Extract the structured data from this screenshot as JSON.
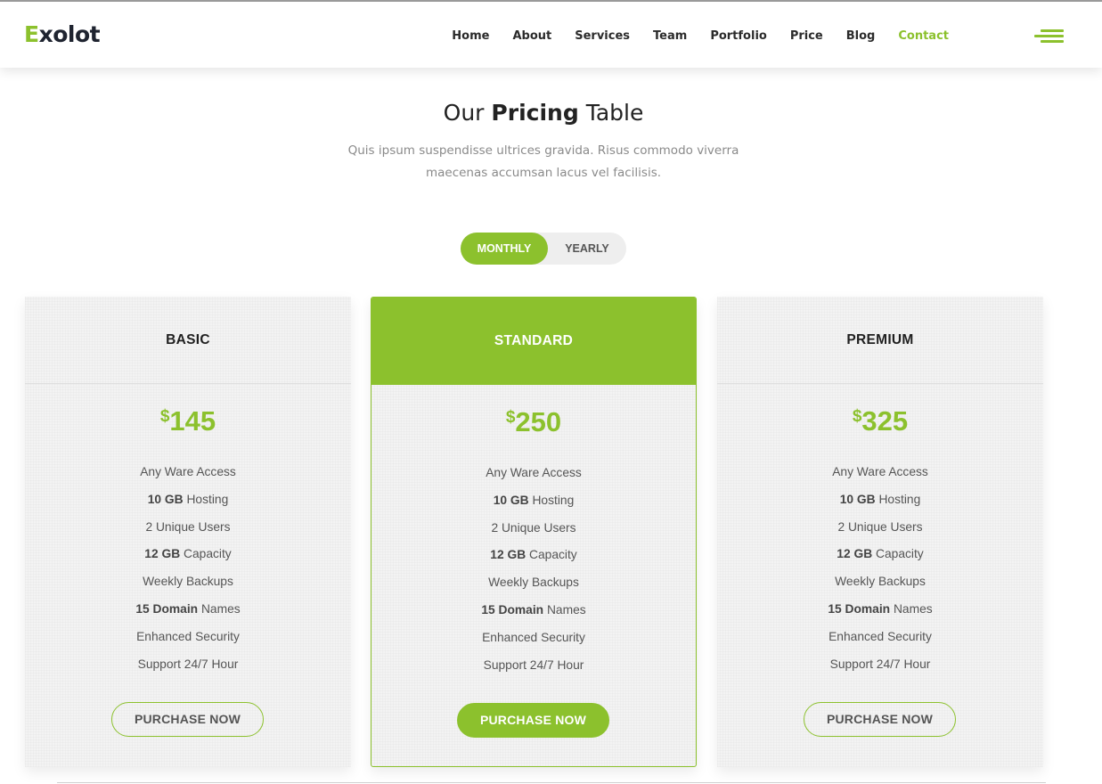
{
  "brand": {
    "first_letter": "E",
    "rest": "xolot",
    "accent_color": "#8cc12d"
  },
  "nav": {
    "items": [
      {
        "label": "Home"
      },
      {
        "label": "About"
      },
      {
        "label": "Services"
      },
      {
        "label": "Team"
      },
      {
        "label": "Portfolio"
      },
      {
        "label": "Price"
      },
      {
        "label": "Blog"
      },
      {
        "label": "Contact",
        "active": true
      }
    ],
    "menu_icon": "hamburger-menu-icon"
  },
  "section": {
    "title_prefix": "Our",
    "title_bold": "Pricing",
    "title_suffix": "Table",
    "description": "Quis ipsum suspendisse ultrices gravida. Risus commodo viverra maecenas accumsan lacus vel facilisis."
  },
  "billing_toggle": {
    "monthly": "MONTHLY",
    "yearly": "YEARLY",
    "selected": "MONTHLY"
  },
  "plans": [
    {
      "name": "BASIC",
      "currency": "$",
      "price": "145",
      "featured": false,
      "features": [
        {
          "bold": "",
          "text": "Any Ware Access"
        },
        {
          "bold": "10 GB",
          "text": " Hosting"
        },
        {
          "bold": "",
          "text": "2 Unique Users"
        },
        {
          "bold": "12 GB",
          "text": " Capacity"
        },
        {
          "bold": "",
          "text": "Weekly Backups"
        },
        {
          "bold": "15 Domain",
          "text": " Names"
        },
        {
          "bold": "",
          "text": "Enhanced Security"
        },
        {
          "bold": "",
          "text": "Support 24/7 Hour"
        }
      ],
      "button": "PURCHASE NOW"
    },
    {
      "name": "STANDARD",
      "currency": "$",
      "price": "250",
      "featured": true,
      "features": [
        {
          "bold": "",
          "text": "Any Ware Access"
        },
        {
          "bold": "10 GB",
          "text": " Hosting"
        },
        {
          "bold": "",
          "text": "2 Unique Users"
        },
        {
          "bold": "12 GB",
          "text": " Capacity"
        },
        {
          "bold": "",
          "text": "Weekly Backups"
        },
        {
          "bold": "15 Domain",
          "text": " Names"
        },
        {
          "bold": "",
          "text": "Enhanced Security"
        },
        {
          "bold": "",
          "text": "Support 24/7 Hour"
        }
      ],
      "button": "PURCHASE NOW"
    },
    {
      "name": "PREMIUM",
      "currency": "$",
      "price": "325",
      "featured": false,
      "features": [
        {
          "bold": "",
          "text": "Any Ware Access"
        },
        {
          "bold": "10 GB",
          "text": " Hosting"
        },
        {
          "bold": "",
          "text": "2 Unique Users"
        },
        {
          "bold": "12 GB",
          "text": " Capacity"
        },
        {
          "bold": "",
          "text": "Weekly Backups"
        },
        {
          "bold": "15 Domain",
          "text": " Names"
        },
        {
          "bold": "",
          "text": "Enhanced Security"
        },
        {
          "bold": "",
          "text": "Support 24/7 Hour"
        }
      ],
      "button": "PURCHASE NOW"
    }
  ]
}
